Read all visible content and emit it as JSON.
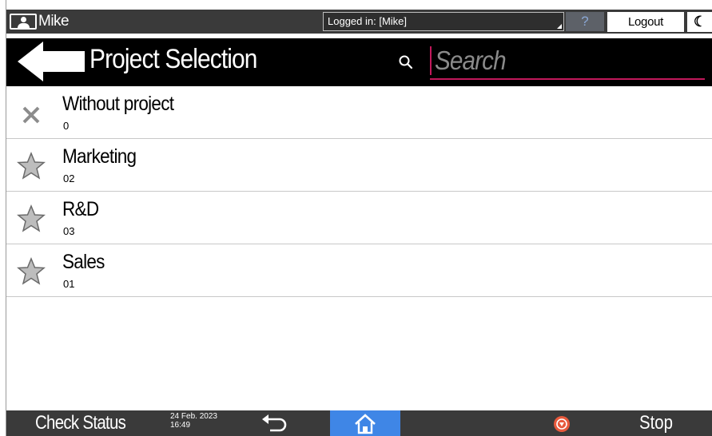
{
  "status_bar": {
    "user_name": "Mike",
    "login_text": "Logged in: [Mike]",
    "help_label": "?",
    "logout_label": "Logout"
  },
  "header": {
    "title": "Project Selection",
    "search_placeholder": "Search"
  },
  "projects": [
    {
      "name": "Without project",
      "code": "0",
      "icon": "close-icon"
    },
    {
      "name": "Marketing",
      "code": "02",
      "icon": "star-icon"
    },
    {
      "name": "R&D",
      "code": "03",
      "icon": "star-icon"
    },
    {
      "name": "Sales",
      "code": "01",
      "icon": "star-icon"
    }
  ],
  "bottom_bar": {
    "check_status_label": "Check Status",
    "date": "24 Feb. 2023",
    "time": "16:49",
    "stop_label": "Stop"
  },
  "colors": {
    "status_bar": "#3a3a3a",
    "title_bar": "#000000",
    "accent": "#c2185b",
    "home": "#3f86e6",
    "stop": "#e8593c"
  }
}
